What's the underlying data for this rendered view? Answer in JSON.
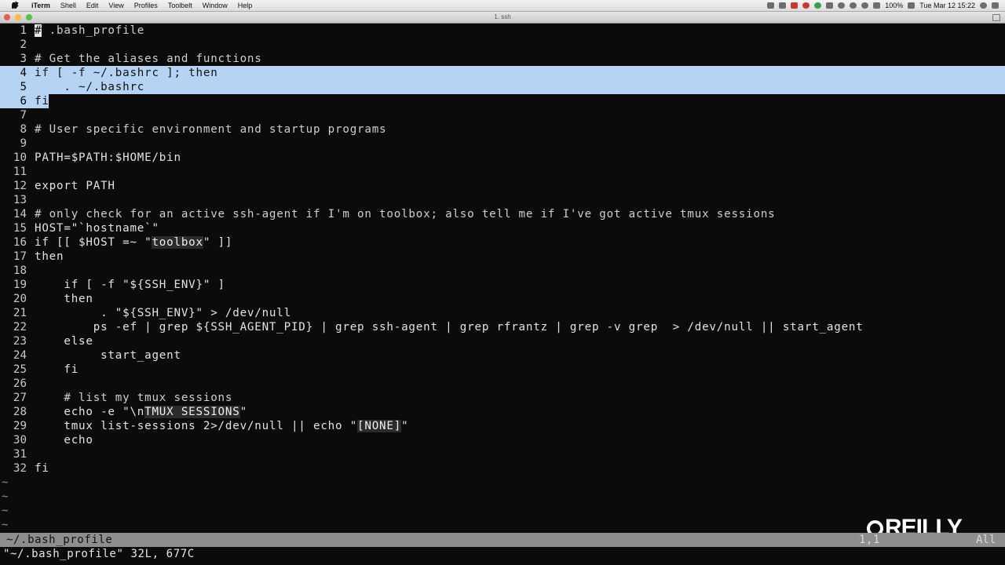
{
  "menubar": {
    "apple": "",
    "app_name": "iTerm",
    "items": [
      "Shell",
      "Edit",
      "View",
      "Profiles",
      "Toolbelt",
      "Window",
      "Help"
    ],
    "battery": "100%",
    "clock": "Tue Mar 12  15:22"
  },
  "window": {
    "title": "1. ssh"
  },
  "editor": {
    "cursor_char": "#",
    "lines": [
      {
        "n": "1",
        "text": " .bash_profile"
      },
      {
        "n": "2",
        "text": ""
      },
      {
        "n": "3",
        "text": "# Get the aliases and functions"
      },
      {
        "n": "4",
        "text": "if [ -f ~/.bashrc ]; then"
      },
      {
        "n": "5",
        "text": "    . ~/.bashrc"
      },
      {
        "n": "6",
        "text": "fi"
      },
      {
        "n": "7",
        "text": ""
      },
      {
        "n": "8",
        "text": "# User specific environment and startup programs"
      },
      {
        "n": "9",
        "text": ""
      },
      {
        "n": "10",
        "text": "PATH=$PATH:$HOME/bin"
      },
      {
        "n": "11",
        "text": ""
      },
      {
        "n": "12",
        "text": "export PATH"
      },
      {
        "n": "13",
        "text": ""
      },
      {
        "n": "14",
        "text": "# only check for an active ssh-agent if I'm on toolbox; also tell me if I've got active tmux sessions"
      },
      {
        "n": "15",
        "text": "HOST=\"`hostname`\""
      },
      {
        "n": "16",
        "a": "if [[ $HOST =~ \"",
        "b": "toolbox",
        "c": "\" ]]"
      },
      {
        "n": "17",
        "text": "then"
      },
      {
        "n": "18",
        "text": ""
      },
      {
        "n": "19",
        "text": "    if [ -f \"${SSH_ENV}\" ]"
      },
      {
        "n": "20",
        "text": "    then"
      },
      {
        "n": "21",
        "text": "         . \"${SSH_ENV}\" > /dev/null"
      },
      {
        "n": "22",
        "text": "        ps -ef | grep ${SSH_AGENT_PID} | grep ssh-agent | grep rfrantz | grep -v grep  > /dev/null || start_agent"
      },
      {
        "n": "23",
        "text": "    else"
      },
      {
        "n": "24",
        "text": "         start_agent"
      },
      {
        "n": "25",
        "text": "    fi"
      },
      {
        "n": "26",
        "text": ""
      },
      {
        "n": "27",
        "text": "    # list my tmux sessions"
      },
      {
        "n": "28",
        "a": "    echo -e \"\\n",
        "b": "TMUX SESSIONS",
        "c": "\""
      },
      {
        "n": "29",
        "a": "    tmux list-sessions 2>/dev/null || echo \"",
        "b": "[NONE]",
        "c": "\""
      },
      {
        "n": "30",
        "text": "    echo"
      },
      {
        "n": "31",
        "text": ""
      },
      {
        "n": "32",
        "text": "fi"
      }
    ],
    "tildes": [
      "~",
      "~",
      "~",
      "~"
    ]
  },
  "statusline": {
    "filename": "~/.bash_profile",
    "position": "1,1",
    "scroll": "All"
  },
  "cmdline": {
    "info": "\"~/.bash_profile\" 32L, 677C"
  },
  "watermark": {
    "text": "REILLY",
    "brand": "O'REILLY"
  },
  "colors": {
    "background": "#0b0b0b",
    "selection": "#b5d3f3",
    "statusline": "#8e8e8e",
    "text": "#e3e3e3"
  }
}
